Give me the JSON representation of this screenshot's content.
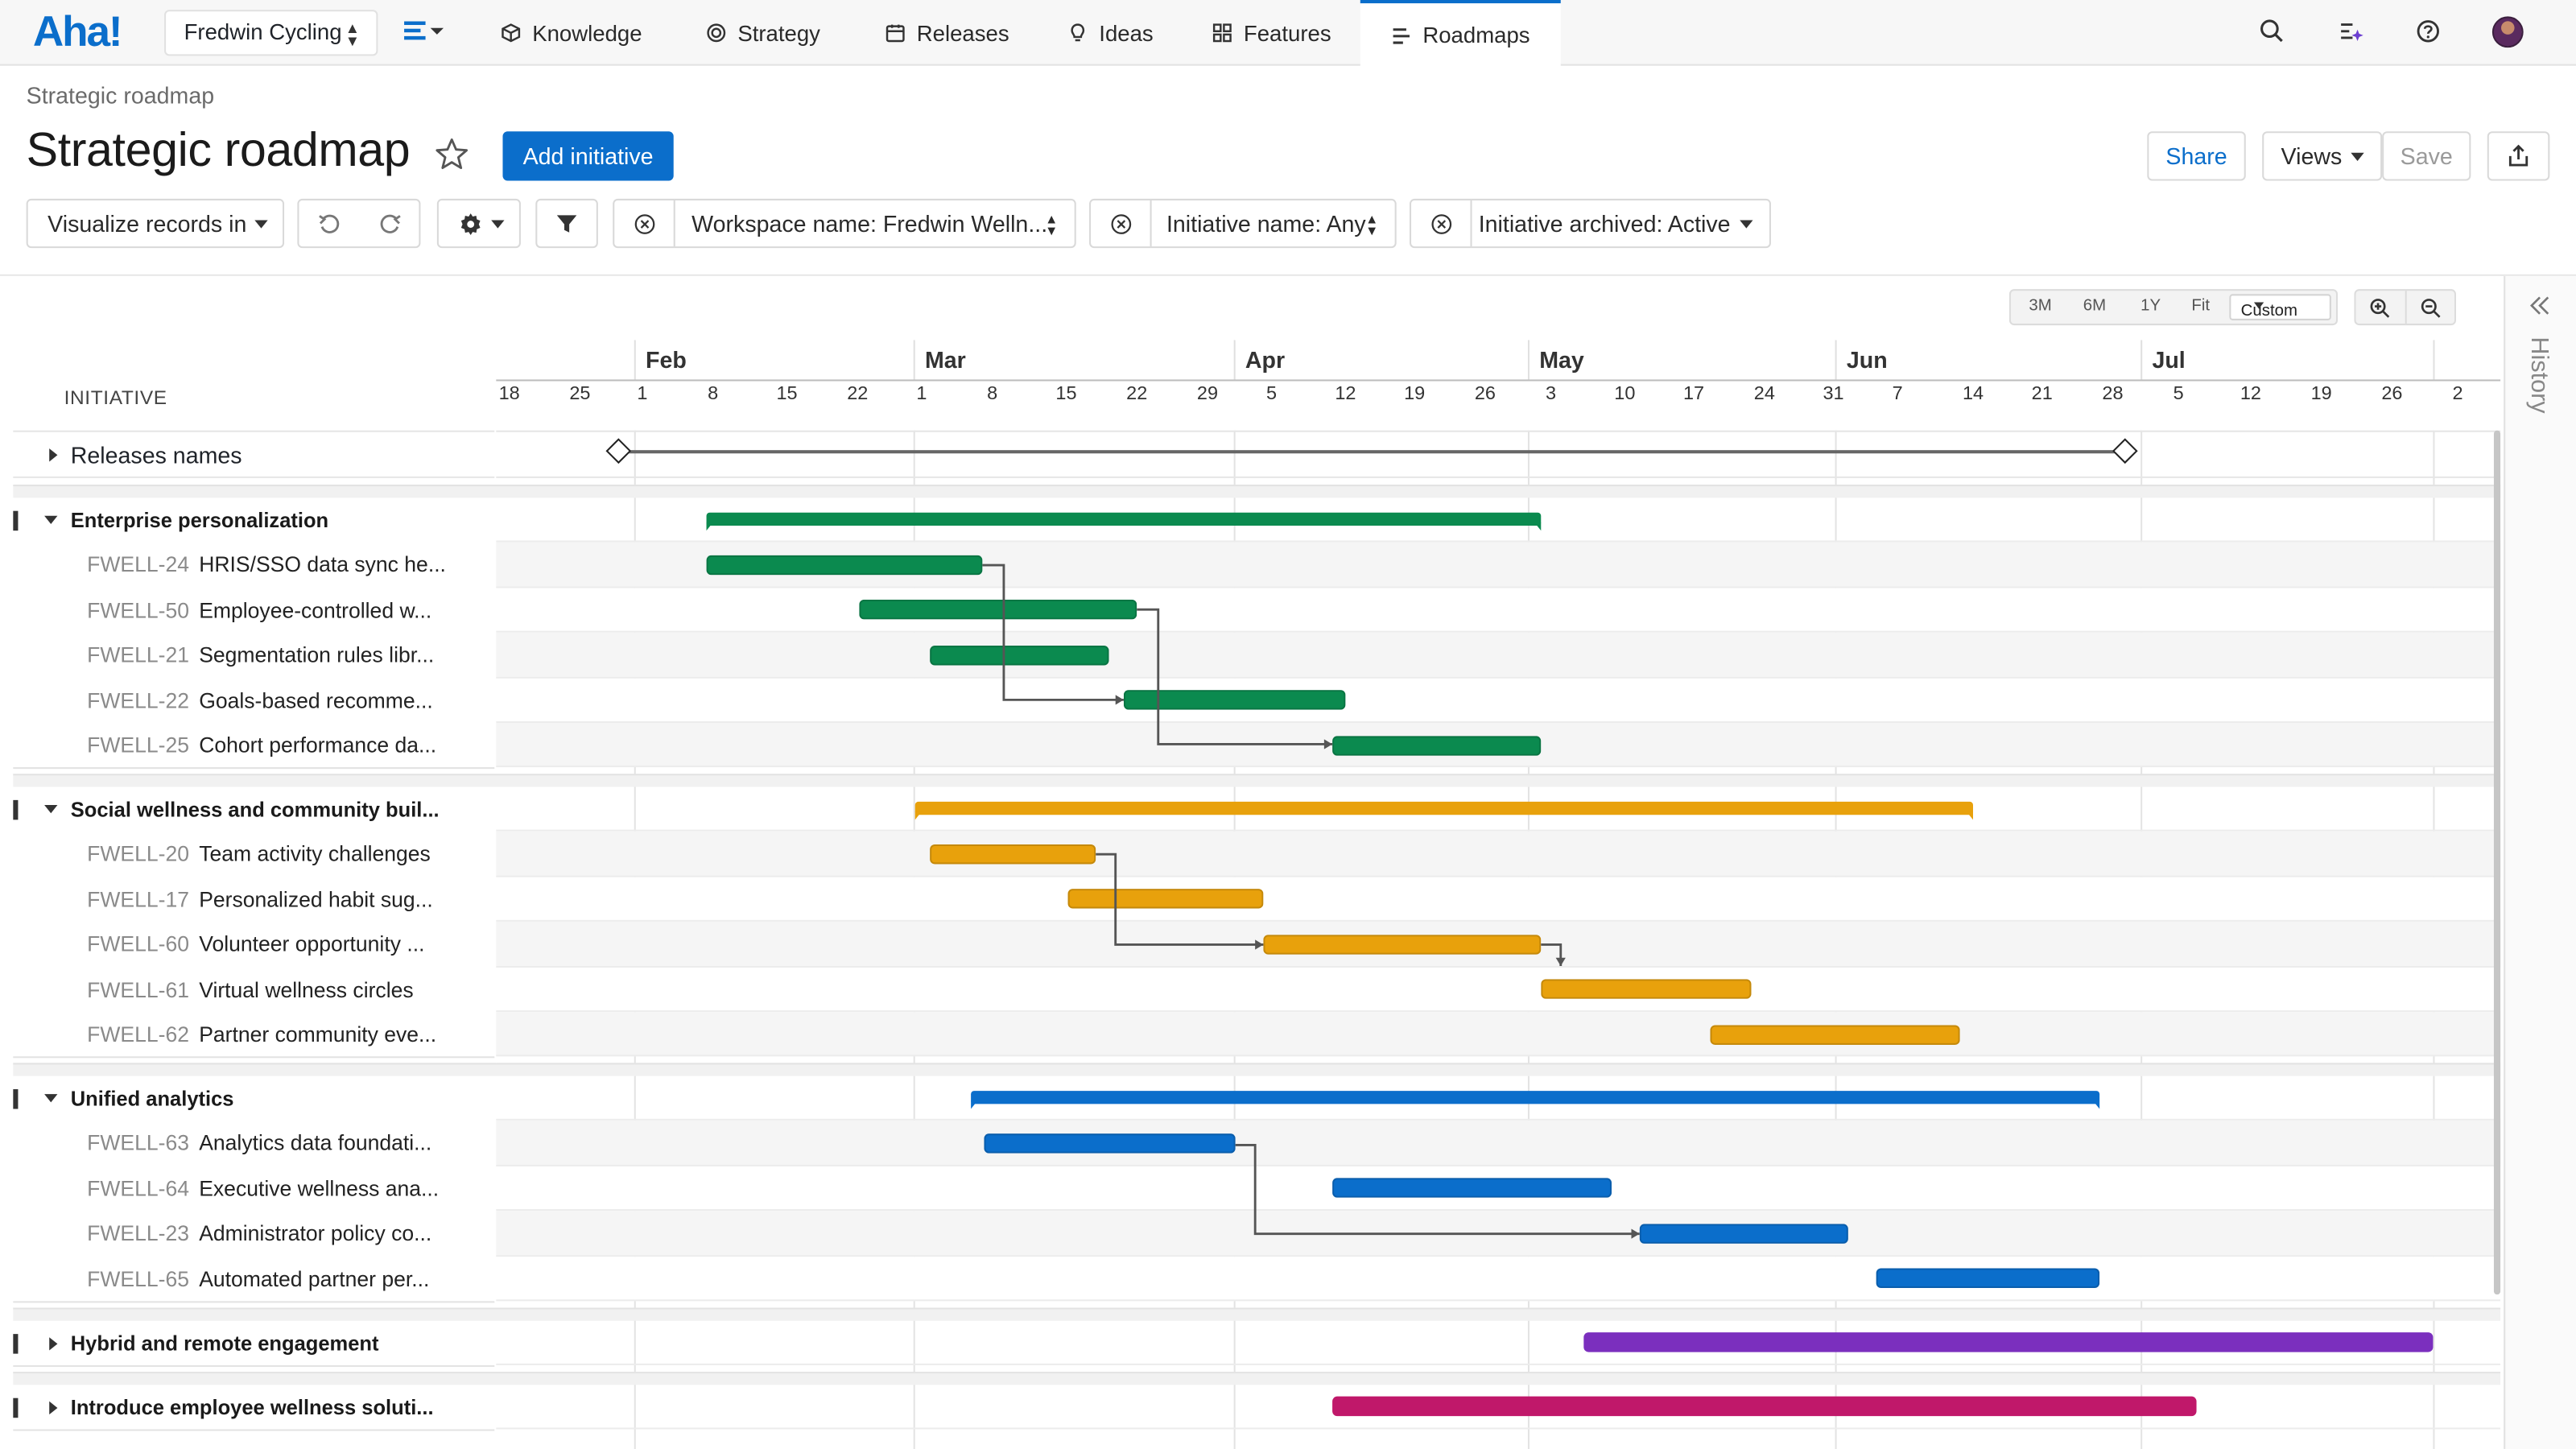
{
  "app": {
    "logo": "Aha!",
    "workspace": "Fredwin Cycling",
    "nav": [
      "Knowledge",
      "Strategy",
      "Releases",
      "Ideas",
      "Features",
      "Roadmaps"
    ],
    "active_nav": "Roadmaps"
  },
  "header": {
    "breadcrumb": "Strategic roadmap",
    "title": "Strategic roadmap",
    "add_button": "Add initiative",
    "share": "Share",
    "views": "Views",
    "save": "Save"
  },
  "filters": {
    "visualize": "Visualize records in",
    "workspace": "Workspace name: Fredwin Welln...",
    "initiative_name": "Initiative name: Any",
    "archived": "Initiative archived: Active"
  },
  "timeline": {
    "column_header": "INITIATIVE",
    "zoom": [
      "3M",
      "6M",
      "1Y",
      "Fit"
    ],
    "zoom_selected": "Custom",
    "months": [
      "Feb",
      "Mar",
      "Apr",
      "May",
      "Jun",
      "Jul"
    ],
    "days": [
      "18",
      "25",
      "1",
      "8",
      "15",
      "22",
      "1",
      "8",
      "15",
      "22",
      "29",
      "5",
      "12",
      "19",
      "26",
      "3",
      "10",
      "17",
      "24",
      "31",
      "7",
      "14",
      "21",
      "28",
      "5",
      "12",
      "19",
      "26",
      "2"
    ],
    "history": "History"
  },
  "releases_row": {
    "label": "Releases names"
  },
  "groups": [
    {
      "name": "Enterprise personalization",
      "color": "#0b8a4f",
      "expanded": true,
      "items": [
        {
          "key": "FWELL-24",
          "name": "HRIS/SSO data sync he..."
        },
        {
          "key": "FWELL-50",
          "name": "Employee-controlled w..."
        },
        {
          "key": "FWELL-21",
          "name": "Segmentation rules libr..."
        },
        {
          "key": "FWELL-22",
          "name": "Goals-based recomme..."
        },
        {
          "key": "FWELL-25",
          "name": "Cohort performance da..."
        }
      ]
    },
    {
      "name": "Social wellness and community buil...",
      "color": "#e8a10c",
      "expanded": true,
      "items": [
        {
          "key": "FWELL-20",
          "name": "Team activity challenges"
        },
        {
          "key": "FWELL-17",
          "name": "Personalized habit sug..."
        },
        {
          "key": "FWELL-60",
          "name": "Volunteer opportunity ..."
        },
        {
          "key": "FWELL-61",
          "name": "Virtual wellness circles"
        },
        {
          "key": "FWELL-62",
          "name": "Partner community eve..."
        }
      ]
    },
    {
      "name": "Unified analytics",
      "color": "#0b6ecb",
      "expanded": true,
      "items": [
        {
          "key": "FWELL-63",
          "name": "Analytics data foundati..."
        },
        {
          "key": "FWELL-64",
          "name": "Executive wellness ana..."
        },
        {
          "key": "FWELL-23",
          "name": "Administrator policy co..."
        },
        {
          "key": "FWELL-65",
          "name": "Automated partner per..."
        }
      ]
    },
    {
      "name": "Hybrid and remote engagement",
      "color": "#7b2fbe",
      "expanded": false,
      "items": []
    },
    {
      "name": "Introduce employee wellness soluti...",
      "color": "#c0186a",
      "expanded": false,
      "items": []
    }
  ]
}
